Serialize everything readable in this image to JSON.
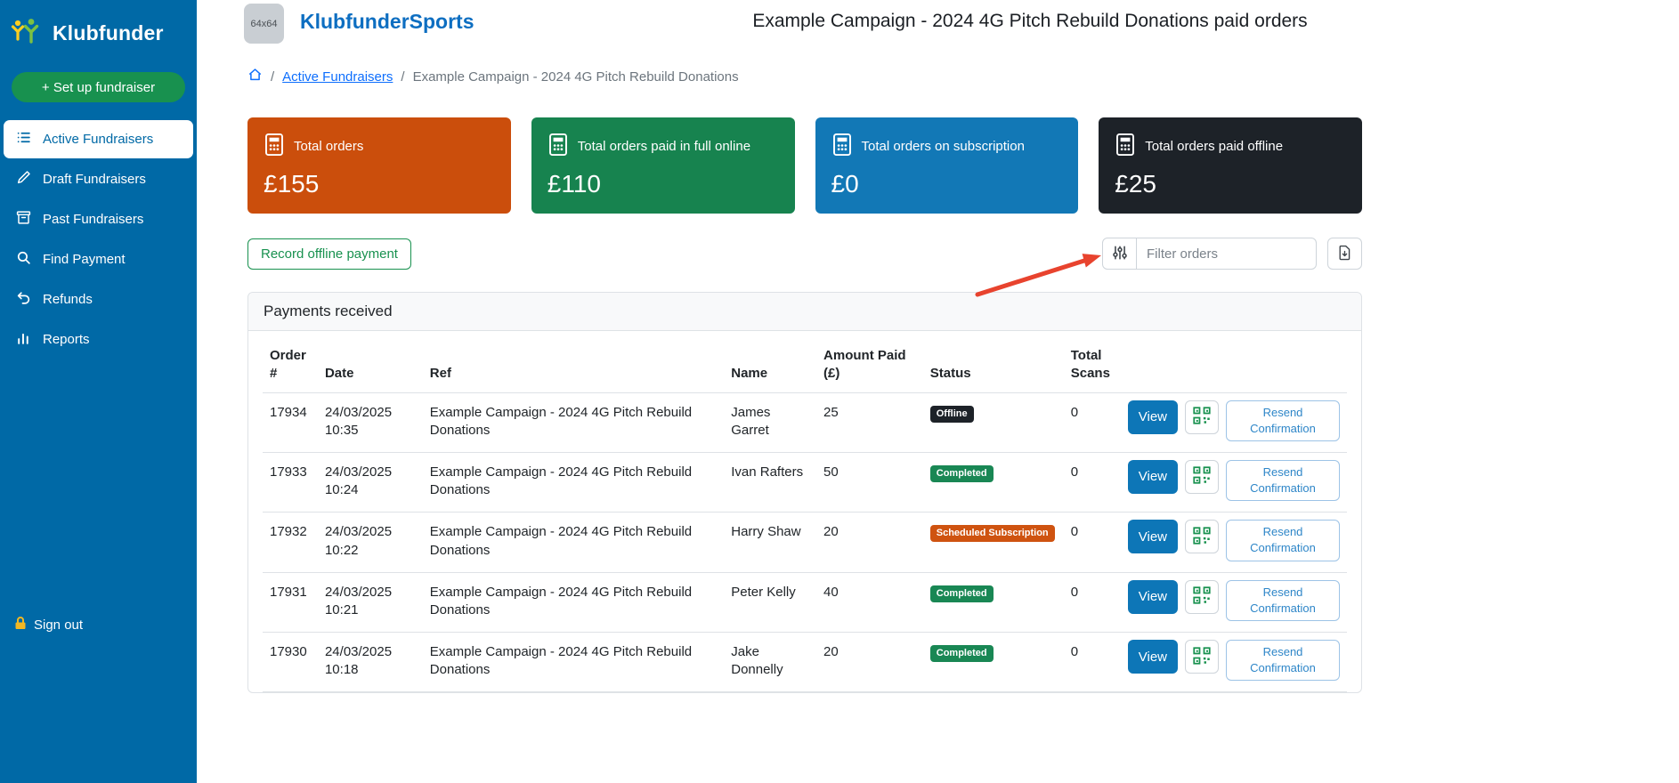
{
  "sidebar": {
    "logo_text": "Klubfunder",
    "setup_button": "+ Set up fundraiser",
    "items": [
      {
        "label": "Active Fundraisers"
      },
      {
        "label": "Draft Fundraisers"
      },
      {
        "label": "Past Fundraisers"
      },
      {
        "label": "Find Payment"
      },
      {
        "label": "Refunds"
      },
      {
        "label": "Reports"
      }
    ],
    "sign_out_label": "Sign out"
  },
  "header": {
    "avatar_placeholder": "64x64",
    "org_name": "KlubfunderSports",
    "page_title": "Example Campaign - 2024 4G Pitch Rebuild Donations paid orders"
  },
  "breadcrumb": {
    "separator": "/",
    "active_link": "Active Fundraisers",
    "current": "Example Campaign - 2024 4G Pitch Rebuild Donations"
  },
  "stats": [
    {
      "label": "Total orders",
      "value": "£155",
      "color": "#cb4e0c"
    },
    {
      "label": "Total orders paid in full online",
      "value": "£110",
      "color": "#17834f"
    },
    {
      "label": "Total orders on subscription",
      "value": "£0",
      "color": "#1278b6"
    },
    {
      "label": "Total orders paid offline",
      "value": "£25",
      "color": "#1d2228"
    }
  ],
  "toolbar": {
    "record_offline_label": "Record offline payment",
    "filter_placeholder": "Filter orders"
  },
  "payments": {
    "title": "Payments received",
    "columns": [
      "Order #",
      "Date",
      "Ref",
      "Name",
      "Amount Paid (£)",
      "Status",
      "Total Scans"
    ],
    "view_label": "View",
    "resend_label": "Resend Confirmation",
    "rows": [
      {
        "order": "17934",
        "date": "24/03/2025 10:35",
        "ref": "Example Campaign - 2024 4G Pitch Rebuild Donations",
        "name": "James Garret",
        "amount": "25",
        "status": "Offline",
        "status_color": "#1d2228",
        "scans": "0"
      },
      {
        "order": "17933",
        "date": "24/03/2025 10:24",
        "ref": "Example Campaign - 2024 4G Pitch Rebuild Donations",
        "name": "Ivan Rafters",
        "amount": "50",
        "status": "Completed",
        "status_color": "#198754",
        "scans": "0"
      },
      {
        "order": "17932",
        "date": "24/03/2025 10:22",
        "ref": "Example Campaign - 2024 4G Pitch Rebuild Donations",
        "name": "Harry Shaw",
        "amount": "20",
        "status": "Scheduled Subscription",
        "status_color": "#cf5310",
        "scans": "0"
      },
      {
        "order": "17931",
        "date": "24/03/2025 10:21",
        "ref": "Example Campaign - 2024 4G Pitch Rebuild Donations",
        "name": "Peter Kelly",
        "amount": "40",
        "status": "Completed",
        "status_color": "#198754",
        "scans": "0"
      },
      {
        "order": "17930",
        "date": "24/03/2025 10:18",
        "ref": "Example Campaign - 2024 4G Pitch Rebuild Donations",
        "name": "Jake Donnelly",
        "amount": "20",
        "status": "Completed",
        "status_color": "#198754",
        "scans": "0"
      }
    ]
  },
  "annotation": {
    "arrow_color": "#e8432e"
  }
}
